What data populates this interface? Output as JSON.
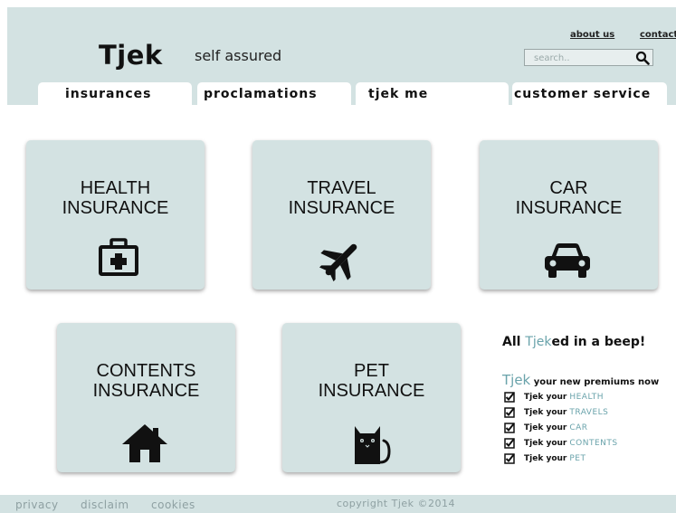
{
  "brand": {
    "logo": "Tjek",
    "tagline": "self assured"
  },
  "top_links": {
    "about": "about us",
    "contact": "contact"
  },
  "search": {
    "placeholder": "search..",
    "icon": "search-icon"
  },
  "tabs": [
    {
      "label": "insurances",
      "active": true
    },
    {
      "label": "proclamations",
      "active": false
    },
    {
      "label": "tjek me",
      "active": false
    },
    {
      "label": "customer service",
      "active": false
    }
  ],
  "cards": [
    {
      "title": "HEALTH\nINSURANCE",
      "icon": "first-aid-kit-icon"
    },
    {
      "title": "TRAVEL\nINSURANCE",
      "icon": "airplane-icon"
    },
    {
      "title": "CAR\nINSURANCE",
      "icon": "car-icon"
    },
    {
      "title": "CONTENTS\nINSURANCE",
      "icon": "house-icon"
    },
    {
      "title": "PET\nINSURANCE",
      "icon": "cat-icon"
    }
  ],
  "promo": {
    "head_prefix": "All",
    "head_accent": "Tjek",
    "head_suffix": "ed in a beep!",
    "sub_accent": "Tjek",
    "sub_text": "your new premiums now",
    "item_prefix": "Tjek your",
    "items": [
      "HEALTH",
      "TRAVELS",
      "CAR",
      "CONTENTS",
      "PET"
    ]
  },
  "footer": {
    "links": [
      "privacy",
      "disclaim",
      "cookies"
    ],
    "copyright": "copyright Tjek ©2014"
  },
  "colors": {
    "panel": "#d3e2e2",
    "accent": "#6aa3ab",
    "footer_text": "#8ea0a2"
  }
}
